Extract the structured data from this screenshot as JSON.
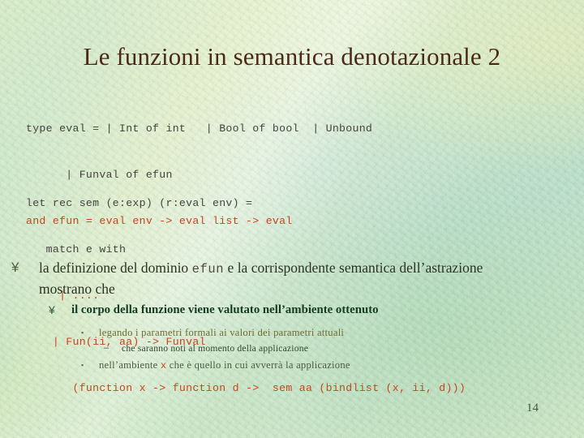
{
  "slide": {
    "title": "Le funzioni in semantica denotazionale 2",
    "page_number": "14",
    "background_colors": {
      "base_green": "#bfe0b8",
      "cream_highlight": "#fffff0",
      "blotch_green": "#96cd96"
    },
    "title_color": "#4a2a16"
  },
  "code_block_1": {
    "color_gray": "#44443f",
    "color_red": "#c8441f",
    "lines": [
      {
        "text": "type eval = | Int of int   | Bool of bool  | Unbound",
        "style": "gray"
      },
      {
        "text": "      | Funval of efun",
        "style": "gray"
      },
      {
        "text": "and efun = eval env -> eval list -> eval",
        "style": "red"
      }
    ]
  },
  "code_block_2": {
    "color_gray": "#44443f",
    "color_red": "#c8441f",
    "lines": [
      {
        "text": "let rec sem (e:exp) (r:eval env) =",
        "style": "gray"
      },
      {
        "text": "   match e with",
        "style": "gray"
      },
      {
        "text": "     | ....",
        "style": "red"
      },
      {
        "text": "    | Fun(ii, aa) -> Funval",
        "style": "red"
      },
      {
        "text": "       (function x -> function d ->  sem aa (bindlist (x, ii, d)))",
        "style": "red"
      }
    ]
  },
  "bullets": {
    "level1": {
      "marker": "¥",
      "marker_name": "yen-bullet-icon",
      "text_before": "la definizione del dominio ",
      "mono": "efun",
      "text_after": " e la corrispondente semantica dell’astrazione mostrano che",
      "color": "#29321f"
    },
    "level2": {
      "marker": "¥",
      "marker_name": "yen-bullet-icon",
      "text": "il corpo della funzione viene valutato nell’ambiente ottenuto",
      "color": "#123b22"
    },
    "level3a": {
      "marker": "▪",
      "marker_name": "square-bullet-icon",
      "text": "legando i parametri formali ai valori dei parametri attuali",
      "color": "#6e6a33"
    },
    "level4": {
      "marker": "–",
      "marker_name": "dash-bullet-icon",
      "text": "che saranno noti al momento della applicazione",
      "color": "#33452f"
    },
    "level3b": {
      "marker": "▪",
      "marker_name": "square-bullet-icon",
      "text_before": "nell’ambiente ",
      "mono": "x",
      "text_after": " che è quello in cui avverrà la applicazione",
      "color": "#4b5b44"
    }
  }
}
